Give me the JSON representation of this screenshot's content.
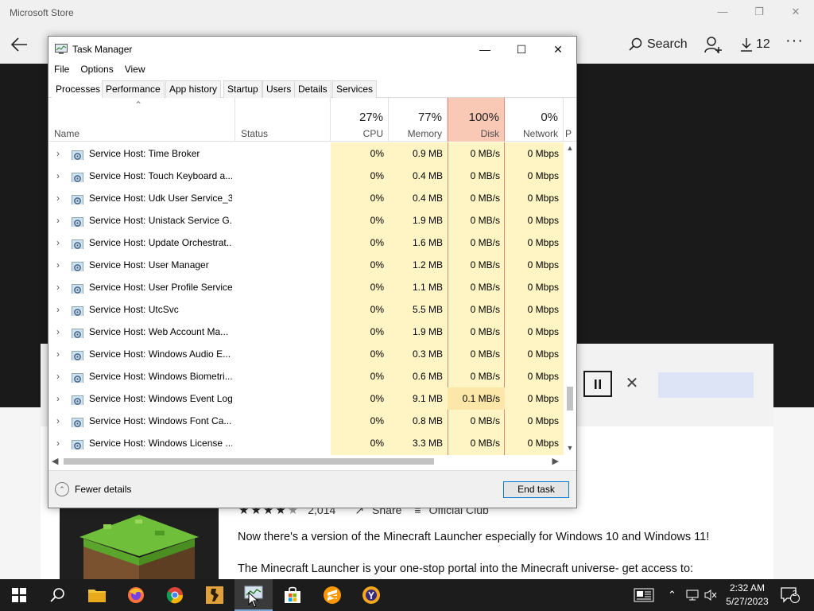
{
  "store": {
    "window_title": "Microsoft Store",
    "search_label": "Search",
    "downloads_count": "12",
    "rating_count": "2,014",
    "share_label": "Share",
    "official_club_label": "Official Club",
    "description_line1": "Now there's a version of the Minecraft Launcher especially for Windows 10 and Windows 11!",
    "description_line2": "The Minecraft Launcher is your one-stop portal into the Minecraft universe- get access to:",
    "stars_filled": 4,
    "stars_total": 5
  },
  "task_manager": {
    "title": "Task Manager",
    "menu": [
      "File",
      "Options",
      "View"
    ],
    "tabs": [
      "Processes",
      "Performance",
      "App history",
      "Startup",
      "Users",
      "Details",
      "Services"
    ],
    "active_tab": "Processes",
    "columns": {
      "name": "Name",
      "status": "Status",
      "cpu": {
        "percent": "27%",
        "label": "CPU"
      },
      "memory": {
        "percent": "77%",
        "label": "Memory"
      },
      "disk": {
        "percent": "100%",
        "label": "Disk"
      },
      "network": {
        "percent": "0%",
        "label": "Network"
      },
      "power": "P"
    },
    "processes": [
      {
        "name": "Service Host: Time Broker",
        "cpu": "0%",
        "memory": "0.9 MB",
        "disk": "0 MB/s",
        "network": "0 Mbps"
      },
      {
        "name": "Service Host: Touch Keyboard a...",
        "cpu": "0%",
        "memory": "0.4 MB",
        "disk": "0 MB/s",
        "network": "0 Mbps"
      },
      {
        "name": "Service Host: Udk User Service_3...",
        "cpu": "0%",
        "memory": "0.4 MB",
        "disk": "0 MB/s",
        "network": "0 Mbps"
      },
      {
        "name": "Service Host: Unistack Service G...",
        "cpu": "0%",
        "memory": "1.9 MB",
        "disk": "0 MB/s",
        "network": "0 Mbps"
      },
      {
        "name": "Service Host: Update Orchestrat...",
        "cpu": "0%",
        "memory": "1.6 MB",
        "disk": "0 MB/s",
        "network": "0 Mbps"
      },
      {
        "name": "Service Host: User Manager",
        "cpu": "0%",
        "memory": "1.2 MB",
        "disk": "0 MB/s",
        "network": "0 Mbps"
      },
      {
        "name": "Service Host: User Profile Service",
        "cpu": "0%",
        "memory": "1.1 MB",
        "disk": "0 MB/s",
        "network": "0 Mbps"
      },
      {
        "name": "Service Host: UtcSvc",
        "cpu": "0%",
        "memory": "5.5 MB",
        "disk": "0 MB/s",
        "network": "0 Mbps"
      },
      {
        "name": "Service Host: Web Account Ma...",
        "cpu": "0%",
        "memory": "1.9 MB",
        "disk": "0 MB/s",
        "network": "0 Mbps"
      },
      {
        "name": "Service Host: Windows Audio E...",
        "cpu": "0%",
        "memory": "0.3 MB",
        "disk": "0 MB/s",
        "network": "0 Mbps"
      },
      {
        "name": "Service Host: Windows Biometri...",
        "cpu": "0%",
        "memory": "0.6 MB",
        "disk": "0 MB/s",
        "network": "0 Mbps"
      },
      {
        "name": "Service Host: Windows Event Log",
        "cpu": "0%",
        "memory": "9.1 MB",
        "disk": "0.1 MB/s",
        "network": "0 Mbps"
      },
      {
        "name": "Service Host: Windows Font Ca...",
        "cpu": "0%",
        "memory": "0.8 MB",
        "disk": "0 MB/s",
        "network": "0 Mbps"
      },
      {
        "name": "Service Host: Windows License ...",
        "cpu": "0%",
        "memory": "3.3 MB",
        "disk": "0 MB/s",
        "network": "0 Mbps"
      }
    ],
    "fewer_details_label": "Fewer details",
    "end_task_label": "End task"
  },
  "taskbar": {
    "time": "2:32 AM",
    "date": "5/27/2023",
    "notification_count": "2",
    "apps": [
      "start-button",
      "search",
      "file-explorer",
      "firefox",
      "chrome",
      "counter-strike",
      "task-manager",
      "microsoft-store",
      "sublime-text",
      "brave-vpn"
    ],
    "active_app": "task-manager"
  },
  "colors": {
    "heat_light": "#fff4c4",
    "heat_disk_header": "#f9c9b6",
    "accent": "#0078d7",
    "taskbar": "#1c1c1c"
  }
}
